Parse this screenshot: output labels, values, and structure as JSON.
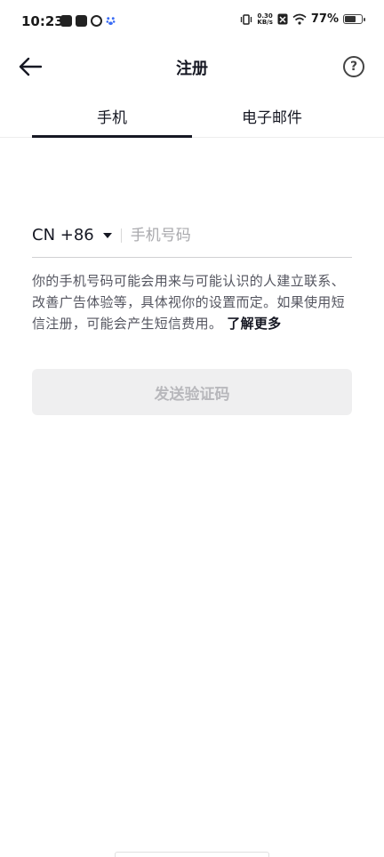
{
  "status_bar": {
    "time": "10:23",
    "net_speed_value": "0.30",
    "net_speed_unit": "KB/s",
    "battery_percent": "77%",
    "battery_level": 0.77
  },
  "header": {
    "title": "注册",
    "help_label": "?"
  },
  "tabs": [
    {
      "label": "手机",
      "active": true
    },
    {
      "label": "电子邮件",
      "active": false
    }
  ],
  "phone_form": {
    "country_code": "CN +86",
    "phone_placeholder": "手机号码",
    "phone_value": ""
  },
  "notice": {
    "text": "你的手机号码可能会用来与可能认识的人建立联系、改善广告体验等，具体视你的设置而定。如果使用短信注册，可能会产生短信费用。",
    "learn_more": "了解更多"
  },
  "send_button": {
    "label": "发送验证码",
    "enabled": false
  },
  "colors": {
    "text_primary": "#161823",
    "text_secondary": "#555660",
    "placeholder": "#a9a9ad",
    "button_disabled_bg": "#efeff0",
    "button_disabled_text": "#b8b8bc"
  }
}
